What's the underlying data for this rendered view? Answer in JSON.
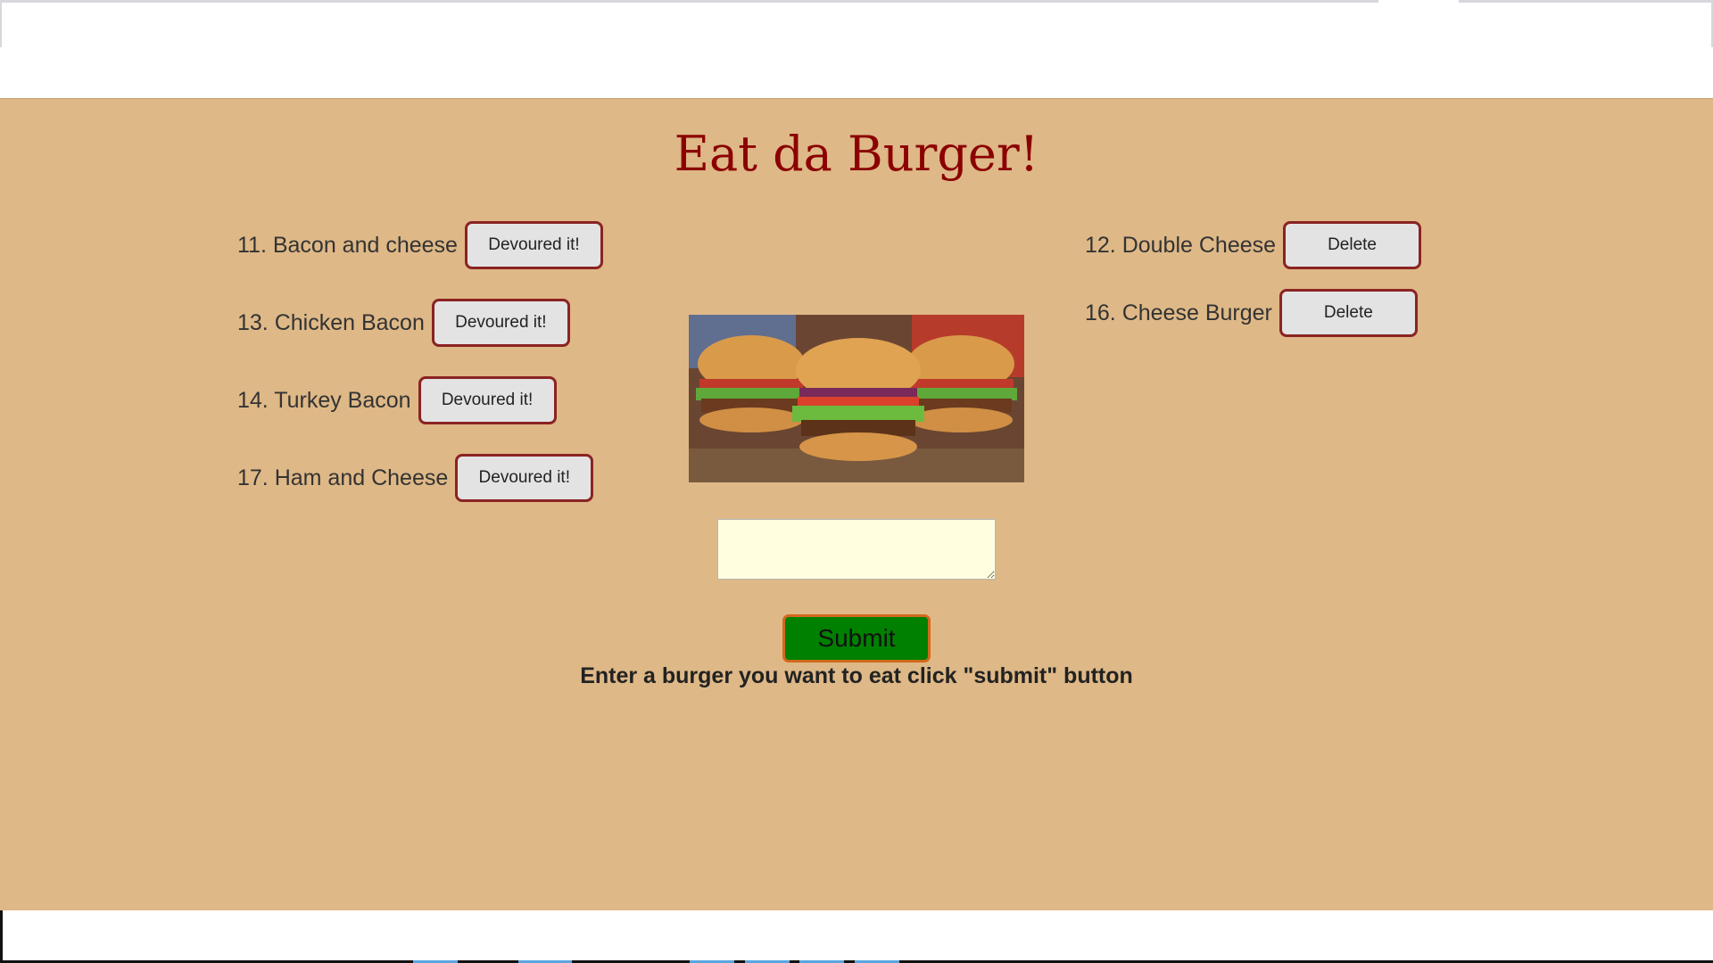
{
  "page": {
    "title": "Eat da Burger!",
    "instruction": "Enter a burger you want to eat click \"submit\" button"
  },
  "not_devoured": [
    {
      "label": "11. Bacon and cheese",
      "button": "Devoured it!"
    },
    {
      "label": "13. Chicken Bacon",
      "button": "Devoured it!"
    },
    {
      "label": "14. Turkey Bacon",
      "button": "Devoured it!"
    },
    {
      "label": "17. Ham and Cheese",
      "button": "Devoured it!"
    }
  ],
  "devoured": [
    {
      "label": "12. Double Cheese",
      "button": "Delete"
    },
    {
      "label": "16. Cheese Burger",
      "button": "Delete"
    }
  ],
  "form": {
    "input_value": "",
    "submit_label": "Submit"
  },
  "colors": {
    "background": "#deb887",
    "title": "#8b0000",
    "submit": "#008000",
    "input": "#ffffe0"
  }
}
